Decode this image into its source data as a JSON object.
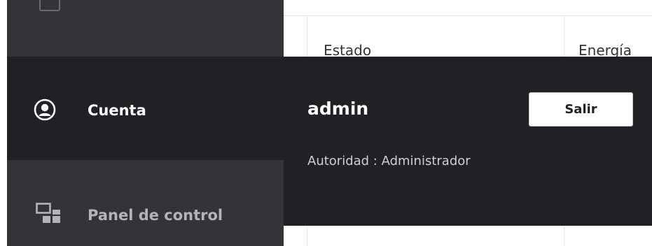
{
  "sidebar": {
    "items": [
      {
        "id": "account",
        "label": "Cuenta",
        "icon": "user-circle-icon",
        "active": true
      },
      {
        "id": "dashboard",
        "label": "Panel de control",
        "icon": "dashboard-icon",
        "active": false
      }
    ]
  },
  "table": {
    "columns": [
      "Estado",
      "Energía"
    ]
  },
  "account_popover": {
    "username": "admin",
    "logout_label": "Salir",
    "authority_text": "Autoridad : Administrador"
  },
  "colors": {
    "sidebar_bg": "#333438",
    "active_bg": "#202125",
    "text_light": "#ffffff",
    "text_muted": "#b3b4b8"
  }
}
